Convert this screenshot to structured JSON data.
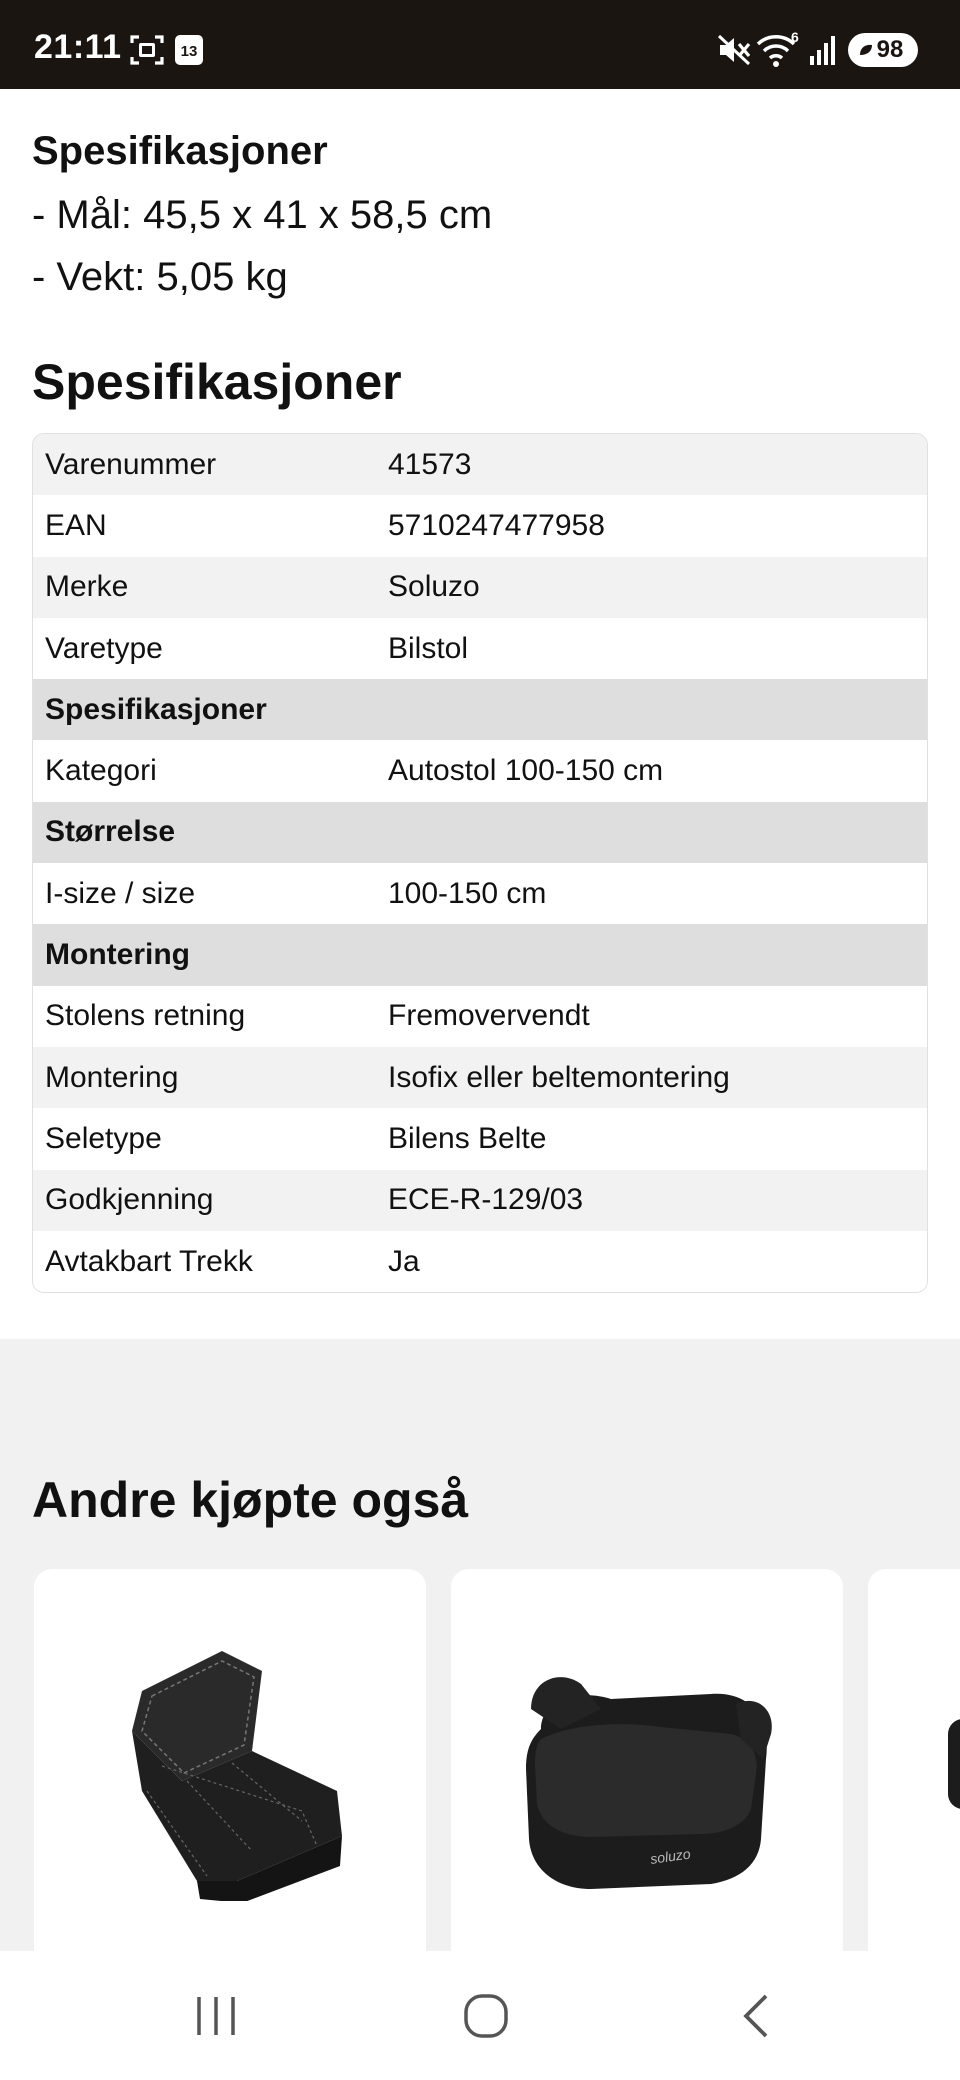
{
  "status_bar": {
    "time": "21:11",
    "icons": [
      "screenshot-icon",
      "calendar-icon",
      "mute-icon",
      "wifi-icon",
      "signal-icon"
    ],
    "calendar_day": "13",
    "wifi_badge": "6",
    "battery": "98"
  },
  "intro": {
    "heading": "Spesifikasjoner",
    "lines": [
      "- Mål: 45,5 x 41 x 58,5 cm",
      "- Vekt: 5,05 kg"
    ]
  },
  "specs": {
    "title": "Spesifikasjoner",
    "rows": [
      {
        "key": "Varenummer",
        "value": "41573"
      },
      {
        "key": "EAN",
        "value": "5710247477958"
      },
      {
        "key": "Merke",
        "value": "Soluzo"
      },
      {
        "key": "Varetype",
        "value": "Bilstol"
      },
      {
        "section": "Spesifikasjoner"
      },
      {
        "key": "Kategori",
        "value": "Autostol 100-150 cm"
      },
      {
        "section": "Størrelse"
      },
      {
        "key": "I-size / size",
        "value": "100-150 cm"
      },
      {
        "section": "Montering"
      },
      {
        "key": "Stolens retning",
        "value": "Fremovervendt"
      },
      {
        "key": "Montering",
        "value": "Isofix eller beltemontering"
      },
      {
        "key": "Seletype",
        "value": "Bilens Belte"
      },
      {
        "key": "Godkjenning",
        "value": "ECE-R-129/03"
      },
      {
        "key": "Avtakbart Trekk",
        "value": "Ja"
      }
    ]
  },
  "also_bought": {
    "title": "Andre kjøpte også",
    "products": [
      {
        "image": "seat-protector-mat-image"
      },
      {
        "image": "booster-cushion-image",
        "brand_mark": "soluzo"
      },
      {
        "image": "product-image-partial"
      }
    ]
  },
  "nav_bar": {
    "buttons": [
      "recent-apps-icon",
      "home-icon",
      "back-icon"
    ]
  }
}
